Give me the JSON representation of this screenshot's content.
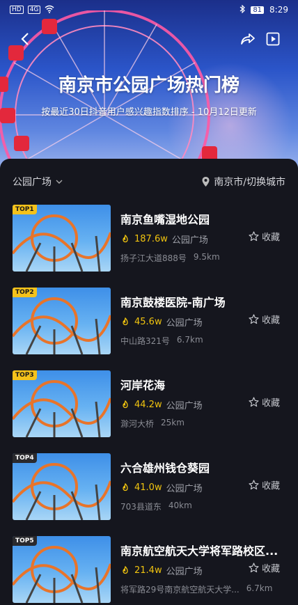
{
  "status_bar": {
    "left_chips": [
      "HD",
      "4G"
    ],
    "battery": "81",
    "time": "8:29"
  },
  "header": {
    "title": "南京市公园广场热门榜",
    "subtitle": "按最近30日抖音用户感兴趣指数排序 - 10月12日更新"
  },
  "filter": {
    "category": "公园广场",
    "city": "南京市/切换城市"
  },
  "list": [
    {
      "rank": "TOP1",
      "name": "南京鱼嘴湿地公园",
      "heat": "187.6w",
      "category": "公园广场",
      "address": "扬子江大道888号",
      "distance": "9.5km",
      "fav": "收藏"
    },
    {
      "rank": "TOP2",
      "name": "南京鼓楼医院-南广场",
      "heat": "45.6w",
      "category": "公园广场",
      "address": "中山路321号",
      "distance": "6.7km",
      "fav": "收藏"
    },
    {
      "rank": "TOP3",
      "name": "河岸花海",
      "heat": "44.2w",
      "category": "公园广场",
      "address": "滁河大桥",
      "distance": "25km",
      "fav": "收藏"
    },
    {
      "rank": "TOP4",
      "name": "六合雄州钱仓葵园",
      "heat": "41.0w",
      "category": "公园广场",
      "address": "703县道东",
      "distance": "40km",
      "fav": "收藏"
    },
    {
      "rank": "TOP5",
      "name": "南京航空航天大学将军路校区...",
      "heat": "21.4w",
      "category": "公园广场",
      "address": "将军路29号南京航空航天大学...",
      "distance": "6.7km",
      "fav": "收藏"
    }
  ],
  "colors": {
    "gold": "#f4c21b",
    "heat": "#f1c40f",
    "background": "#15161e"
  }
}
